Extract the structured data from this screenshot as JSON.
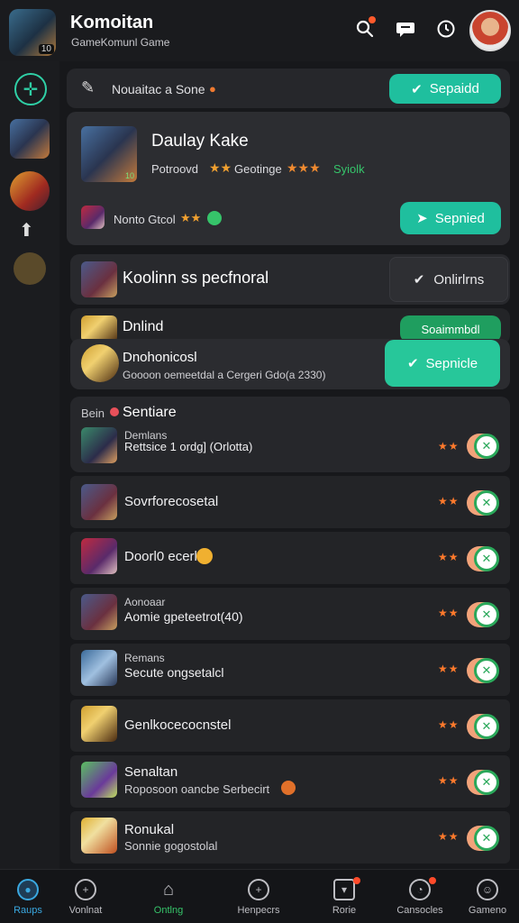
{
  "header": {
    "title": "Komoitan",
    "subtitle": "GameKomunl Game",
    "app_badge": "10"
  },
  "top_bar": {
    "label": "Nouaitac a Sone",
    "button": "Sepaidd"
  },
  "featured": {
    "title": "Daulay Kake",
    "line": "Potroovd",
    "line_mid": "Geotinge",
    "line_green": "Syiolk",
    "thumb_badge": "10",
    "sub_label": "Nonto Gtcol",
    "button": "Sepnied"
  },
  "section2": {
    "title": "Koolinn ss pecfnoral",
    "right_button": "Onlirlrns",
    "row_label": "Dnlind",
    "row_button": "Soaimmbdl",
    "overlay_title": "Dnohonicosl",
    "overlay_sub": "Goooon oemeetdal a Cergeri Gdo(a 2330)",
    "overlay_button": "Sepnicle"
  },
  "list_header": {
    "prefix": "Bein",
    "title": "Sentiare"
  },
  "list": [
    {
      "small_top": "Demlans",
      "name": "Rettsice 1 ordg] (Orlotta)"
    },
    {
      "name": "Sovrforecosetal"
    },
    {
      "name": "Doorl0 ecerl"
    },
    {
      "small_top": "Aonoaar",
      "name": "Aomie gpeteetrot(40)"
    },
    {
      "small_top": "Remans",
      "name": "Secute ongsetalcl"
    },
    {
      "name": "Genlkocecocnstel"
    },
    {
      "name": "Senaltan",
      "sub": "Roposoon oancbe Serbecirt"
    },
    {
      "name": "Ronukal",
      "sub": "Sonnie gogostolal"
    }
  ],
  "bottom_nav": [
    {
      "label": "Raups",
      "icon": "home-icon"
    },
    {
      "label": "Vonlnat",
      "icon": "plus-icon"
    },
    {
      "label": "Ontlng",
      "icon": "house-icon"
    },
    {
      "label": "Henpecrs",
      "icon": "add-icon"
    },
    {
      "label": "Rorie",
      "icon": "box-icon"
    },
    {
      "label": "Cansocles",
      "icon": "compass-icon"
    },
    {
      "label": "Gameno",
      "icon": "profile-icon"
    }
  ]
}
